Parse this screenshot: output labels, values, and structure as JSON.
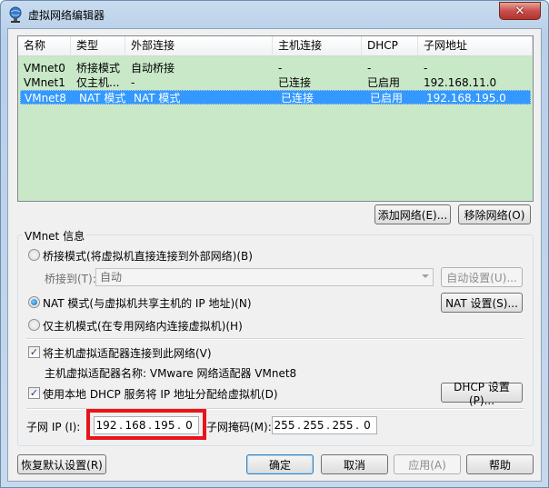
{
  "window": {
    "title": "虚拟网络编辑器",
    "close_glyph": "✕"
  },
  "table": {
    "headers": [
      "名称",
      "类型",
      "外部连接",
      "主机连接",
      "DHCP",
      "子网地址"
    ],
    "rows": [
      {
        "name": "VMnet0",
        "type": "桥接模式",
        "external": "自动桥接",
        "host": "-",
        "dhcp": "-",
        "subnet": "-"
      },
      {
        "name": "VMnet1",
        "type": "仅主机...",
        "external": "-",
        "host": "已连接",
        "dhcp": "已启用",
        "subnet": "192.168.11.0"
      },
      {
        "name": "VMnet8",
        "type": "NAT 模式",
        "external": "NAT 模式",
        "host": "已连接",
        "dhcp": "已启用",
        "subnet": "192.168.195.0"
      }
    ],
    "selected_row": "VMnet8"
  },
  "list_buttons": {
    "add_network": "添加网络(E)...",
    "remove_network": "移除网络(O)"
  },
  "vmnet_info": {
    "legend": "VMnet 信息",
    "bridged_label": "桥接模式(将虚拟机直接连接到外部网络)(B)",
    "bridge_to_label": "桥接到(T):",
    "bridge_to_value": "自动",
    "auto_settings": "自动设置(U)...",
    "nat_label": "NAT 模式(与虚拟机共享主机的 IP 地址)(N)",
    "nat_settings": "NAT 设置(S)...",
    "hostonly_label": "仅主机模式(在专用网络内连接虚拟机)(H)",
    "connect_adapter_label": "将主机虚拟适配器连接到此网络(V)",
    "adapter_name_label": "主机虚拟适配器名称: VMware 网络适配器 VMnet8",
    "dhcp_label": "使用本地 DHCP 服务将 IP 地址分配给虚拟机(D)",
    "dhcp_settings": "DHCP 设置(P)...",
    "subnet_ip_label": "子网 IP (I):",
    "subnet_ip": [
      "192",
      "168",
      "195",
      "0"
    ],
    "subnet_mask_label": "子网掩码(M):",
    "subnet_mask": [
      "255",
      "255",
      "255",
      "0"
    ],
    "mode_selected": "nat",
    "connect_adapter_checked": true,
    "dhcp_checked": true,
    "check_glyph": "✓"
  },
  "footer": {
    "restore_defaults": "恢复默认设置(R)",
    "ok": "确定",
    "cancel": "取消",
    "apply": "应用(A)",
    "help": "帮助"
  },
  "colors": {
    "list_bg": "#c8e8c8",
    "selection": "#3399ff",
    "highlight": "#e8141a"
  }
}
